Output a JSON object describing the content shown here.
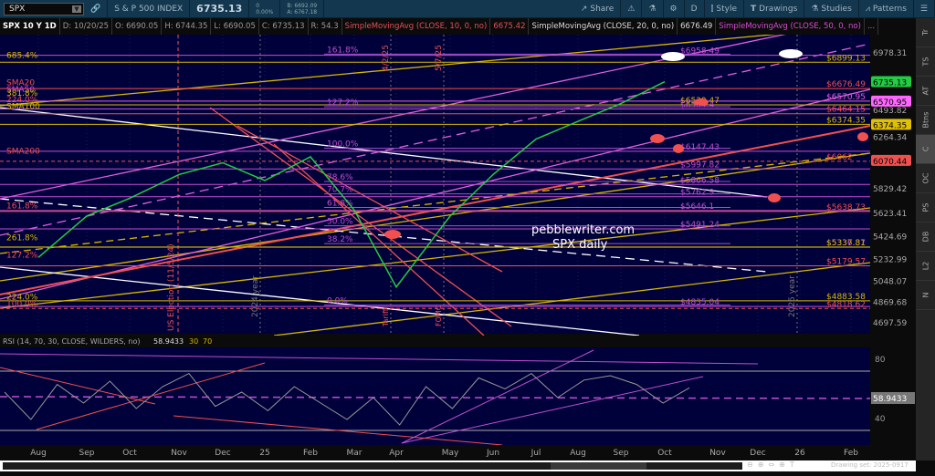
{
  "toolbar": {
    "symbol": "SPX",
    "description": "S & P 500 INDEX",
    "last": "6735.13",
    "change": "0",
    "change_pct": "0.00%",
    "bid": "B: 6692.09",
    "ask": "A: 6767.18",
    "share": "Share",
    "period": "D",
    "style": "Style",
    "drawings": "Drawings",
    "studies": "Studies",
    "patterns": "Patterns"
  },
  "infobar": {
    "title": "SPX 10 Y 1D",
    "date": "D: 10/20/25",
    "open": "O: 6690.05",
    "high": "H: 6744.35",
    "low": "L: 6690.05",
    "close": "C: 6735.13",
    "range": "R: 54.3",
    "sma10": "SimpleMovingAvg (CLOSE, 10, 0, no)",
    "sma10_val": "6675.42",
    "sma20": "SimpleMovingAvg (CLOSE, 20, 0, no)",
    "sma20_val": "6676.49",
    "sma50": "SimpleMovingAvg (CLOSE, 50, 0, no)",
    "more": "..."
  },
  "side_tabs": [
    "Tr",
    "TS",
    "AT",
    "Btns",
    "C",
    "OC",
    "PS",
    "DB",
    "L2",
    "N"
  ],
  "colors": {
    "bg": "#00003a",
    "gold": "#d4b800",
    "red": "#f05050",
    "magenta": "#e060e0",
    "violet": "#a050d0",
    "white": "#ffffff",
    "green": "#22cc44"
  },
  "price_axis": {
    "ticks": [
      "6978.31",
      "6493.82",
      "6264.34",
      "5829.42",
      "5623.41",
      "5424.69",
      "5232.99",
      "5048.07",
      "4869.68",
      "4697.59"
    ],
    "tick_values": [
      6978.31,
      6493.82,
      6264.34,
      5829.42,
      5623.41,
      5424.69,
      5232.99,
      5048.07,
      4869.68,
      4697.59
    ],
    "badges": [
      {
        "label": "6735.13",
        "price": 6735.13,
        "bg": "#22cc44",
        "fg": "#000"
      },
      {
        "label": "6570.95",
        "price": 6570.95,
        "bg": "#ff66ff",
        "fg": "#000"
      },
      {
        "label": "6374.35",
        "price": 6374.35,
        "bg": "#e0c000",
        "fg": "#000"
      },
      {
        "label": "6070.44",
        "price": 6070.44,
        "bg": "#f05050",
        "fg": "#000"
      }
    ]
  },
  "levels": [
    {
      "label": "$6958.49",
      "price": 6958.49,
      "color": "#c050d0"
    },
    {
      "label": "$6899.13",
      "price": 6899.13,
      "color": "#d4b800"
    },
    {
      "label": "$6676.49",
      "price": 6676.49,
      "color": "#f05050"
    },
    {
      "label": "$6570.95",
      "price": 6570.95,
      "color": "#e060e0"
    },
    {
      "label": "$6539.47",
      "price": 6539.47,
      "color": "#d4b800"
    },
    {
      "label": "$6504.4",
      "price": 6504.4,
      "color": "#c050d0"
    },
    {
      "label": "$6464.15",
      "price": 6464.15,
      "color": "#f05050"
    },
    {
      "label": "$6374.35",
      "price": 6374.35,
      "color": "#d4b800"
    },
    {
      "label": "$6147.43",
      "price": 6147.43,
      "color": "#c050d0"
    },
    {
      "label": "$6062",
      "price": 6062,
      "color": "#f05050"
    },
    {
      "label": "$5997.82",
      "price": 5997.82,
      "color": "#c050d0"
    },
    {
      "label": "$5866.58",
      "price": 5866.58,
      "color": "#c050d0"
    },
    {
      "label": "$5762.9",
      "price": 5762.9,
      "color": "#c050d0"
    },
    {
      "label": "$5646.1",
      "price": 5646.1,
      "color": "#c050d0"
    },
    {
      "label": "$5638.73",
      "price": 5638.73,
      "color": "#f05050"
    },
    {
      "label": "$5491.24",
      "price": 5491.24,
      "color": "#c050d0"
    },
    {
      "label": "$5336.37",
      "price": 5336.37,
      "color": "#c050d0"
    },
    {
      "label": "$5337.81",
      "price": 5337.81,
      "color": "#d4b800"
    },
    {
      "label": "$5179.57",
      "price": 5179.57,
      "color": "#f05050"
    },
    {
      "label": "$4883.58",
      "price": 4883.58,
      "color": "#d4b800"
    },
    {
      "label": "$4835.04",
      "price": 4835.04,
      "color": "#c050d0"
    },
    {
      "label": "$4818.62",
      "price": 4818.62,
      "color": "#f05050"
    }
  ],
  "fib_left": [
    {
      "label": "685.4%",
      "price": 6920,
      "color": "#d4b800"
    },
    {
      "label": "SMA20",
      "price": 6690,
      "color": "#f05050"
    },
    {
      "label": "SMA50",
      "price": 6630,
      "color": "#d84ad8"
    },
    {
      "label": "381.8%",
      "price": 6600,
      "color": "#d4b800"
    },
    {
      "label": "224.0%",
      "price": 6545,
      "color": "#f05050"
    },
    {
      "label": "SMA100",
      "price": 6490,
      "color": "#d4b800"
    },
    {
      "label": "SMA200",
      "price": 6110,
      "color": "#f05050"
    },
    {
      "label": "161.8%",
      "price": 5650,
      "color": "#f05050"
    },
    {
      "label": "261.8%",
      "price": 5380,
      "color": "#d4b800"
    },
    {
      "label": "127.2%",
      "price": 5235,
      "color": "#f05050"
    },
    {
      "label": "224.0%",
      "price": 4880,
      "color": "#d4b800"
    },
    {
      "label": "100.0%",
      "price": 4820,
      "color": "#f05050"
    }
  ],
  "fib_mid": [
    {
      "label": "161.8%",
      "price": 6975
    },
    {
      "label": "127.2%",
      "price": 6530
    },
    {
      "label": "100.0%",
      "price": 6180
    },
    {
      "label": "78.6%",
      "price": 5900
    },
    {
      "label": "70.7%",
      "price": 5795
    },
    {
      "label": "61.8%",
      "price": 5680
    },
    {
      "label": "50.0%",
      "price": 5525
    },
    {
      "label": "38.2%",
      "price": 5375
    },
    {
      "label": "0.0%",
      "price": 4855
    }
  ],
  "annotations": {
    "watermark1": "pebblewriter.com",
    "watermark2": "SPX daily",
    "election": "US Election (11/5/24)",
    "year2024": "2024 year",
    "year2025": "2025 year",
    "d1": "4/2/25",
    "d2": "5/7/25",
    "fomc": "FOMC",
    "tariff": "Tariff"
  },
  "x_axis": [
    "Aug",
    "Sep",
    "Oct",
    "Nov",
    "Dec",
    "25",
    "Feb",
    "Mar",
    "Apr",
    "May",
    "Jun",
    "Jul",
    "Aug",
    "Sep",
    "Oct",
    "Nov",
    "Dec",
    "26",
    "Feb"
  ],
  "chart_data": {
    "type": "line",
    "title": "SPX 10 Y 1D",
    "x": [
      "Aug",
      "Sep",
      "Oct",
      "Nov",
      "Dec",
      "25",
      "Feb",
      "Mar",
      "Apr",
      "May",
      "Jun",
      "Jul",
      "Aug",
      "Sep",
      "Oct"
    ],
    "close": [
      5250,
      5600,
      5750,
      5950,
      6050,
      5900,
      6100,
      5650,
      5000,
      5600,
      5950,
      6250,
      6400,
      6550,
      6735.13
    ],
    "ylim": [
      4697.59,
      6978.31
    ]
  },
  "rsi": {
    "header": "RSI (14, 70, 30, CLOSE, WILDERS, no)",
    "value": "58.9433",
    "ob": "30",
    "os": "70",
    "ticks": [
      "80",
      "40"
    ],
    "values": [
      55,
      30,
      62,
      45,
      65,
      40,
      60,
      72,
      42,
      55,
      38,
      60,
      45,
      30,
      50,
      25,
      60,
      40,
      68,
      58,
      72,
      50,
      66,
      70,
      62,
      45,
      58.9
    ]
  },
  "footer": {
    "drawing_set": "Drawing set: 2025-0917"
  }
}
